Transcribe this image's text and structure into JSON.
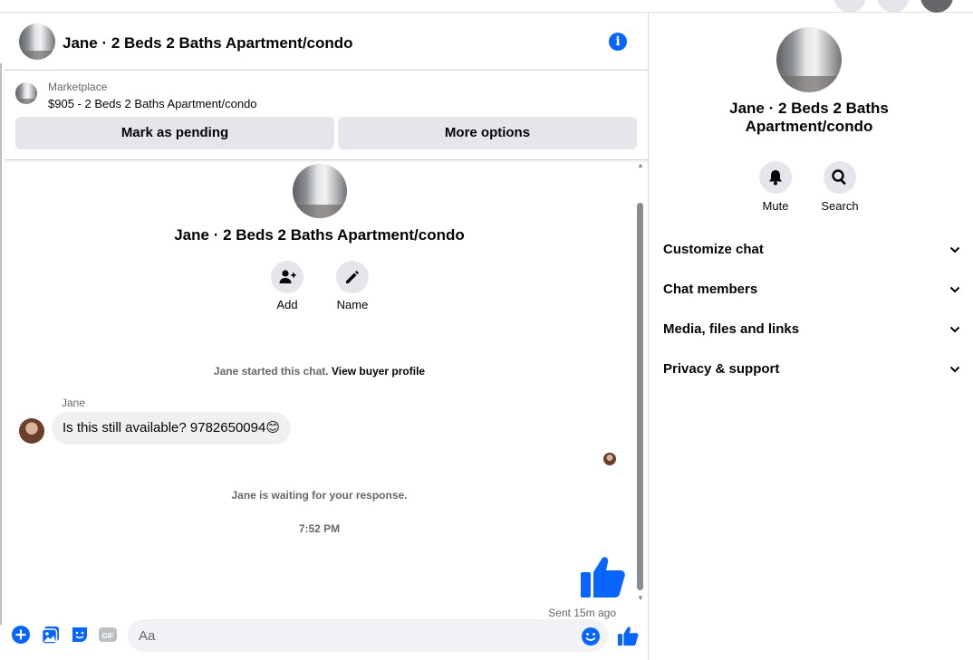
{
  "conversation": {
    "title": "Jane · 2 Beds 2 Baths Apartment/condo"
  },
  "listing": {
    "label": "Marketplace",
    "description": "$905 - 2 Beds 2 Baths Apartment/condo",
    "pending_button": "Mark as pending",
    "more_button": "More options"
  },
  "thread": {
    "title": "Jane · 2 Beds 2 Baths Apartment/condo",
    "actions": [
      {
        "label": "Add",
        "icon": "add-person-icon"
      },
      {
        "label": "Name",
        "icon": "pencil-icon"
      }
    ],
    "started_text": "Jane started this chat.",
    "view_profile_link": "View buyer profile",
    "sender_name": "Jane",
    "message_text": "Is this still available? 9782650094😊",
    "waiting_text": "Jane is waiting for your response.",
    "timestamp": "7:52 PM",
    "sent_status": "Sent 15m ago"
  },
  "composer": {
    "placeholder": "Aa",
    "icons": [
      "plus-icon",
      "photo-icon",
      "sticker-icon",
      "gif-icon",
      "emoji-icon",
      "thumbs-up-icon"
    ]
  },
  "info_panel": {
    "title": "Jane · 2 Beds 2 Baths Apartment/condo",
    "actions": [
      {
        "label": "Mute",
        "icon": "bell-icon"
      },
      {
        "label": "Search",
        "icon": "search-icon"
      }
    ],
    "sections": [
      "Customize chat",
      "Chat members",
      "Media, files and links",
      "Privacy & support"
    ]
  },
  "colors": {
    "accent": "#0866ff",
    "bubble_bg": "#f0f0f0",
    "button_bg": "#e4e6eb",
    "secondary_text": "#65676b"
  }
}
